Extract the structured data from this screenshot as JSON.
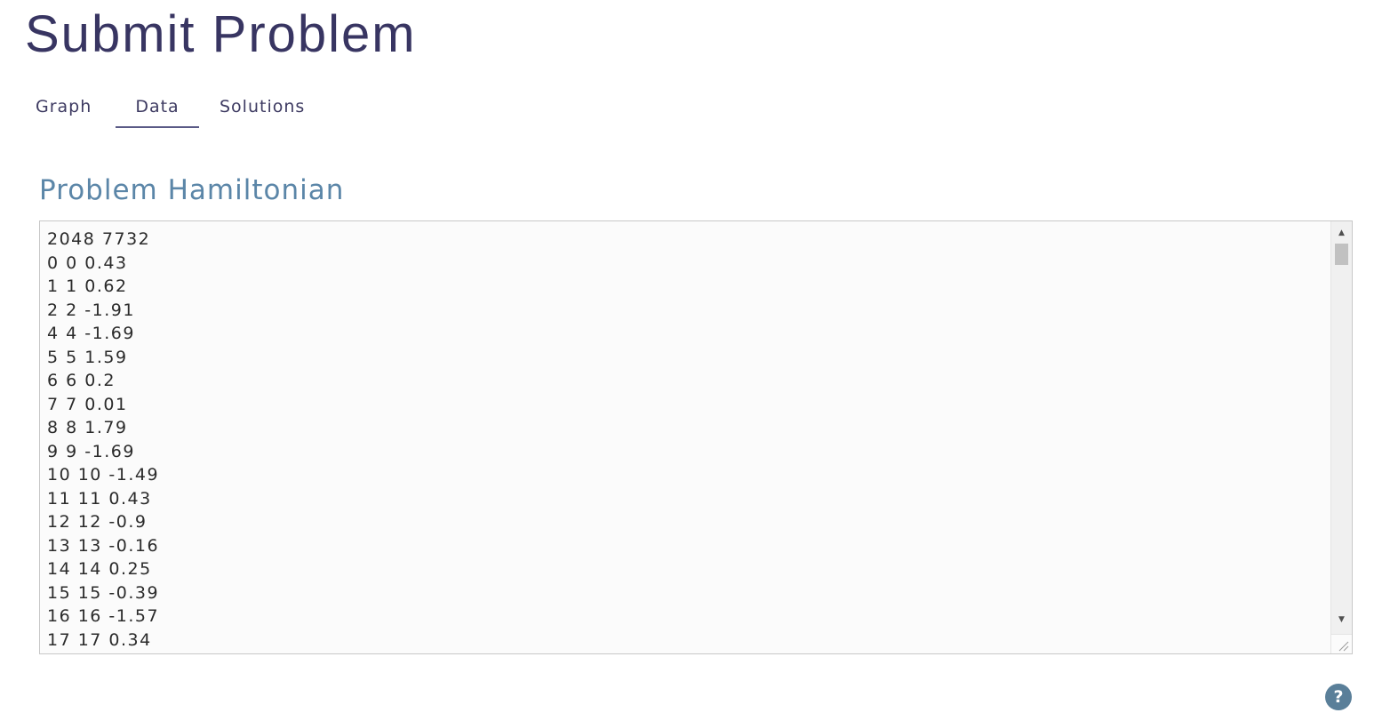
{
  "page": {
    "title": "Submit Problem"
  },
  "tabs": [
    {
      "label": "Graph",
      "active": false
    },
    {
      "label": "Data",
      "active": true
    },
    {
      "label": "Solutions",
      "active": false
    }
  ],
  "section": {
    "title": "Problem Hamiltonian"
  },
  "editor": {
    "value": "2048 7732\n0 0 0.43\n1 1 0.62\n2 2 -1.91\n4 4 -1.69\n5 5 1.59\n6 6 0.2\n7 7 0.01\n8 8 1.79\n9 9 -1.69\n10 10 -1.49\n11 11 0.43\n12 12 -0.9\n13 13 -0.16\n14 14 0.25\n15 15 -0.39\n16 16 -1.57\n17 17 0.34"
  },
  "help": {
    "label": "?",
    "icon": "help-icon"
  },
  "colors": {
    "title": "#383562",
    "section_title": "#5b86a8",
    "tab_underline": "#5a5a86",
    "help_button": "#5a7f99"
  }
}
